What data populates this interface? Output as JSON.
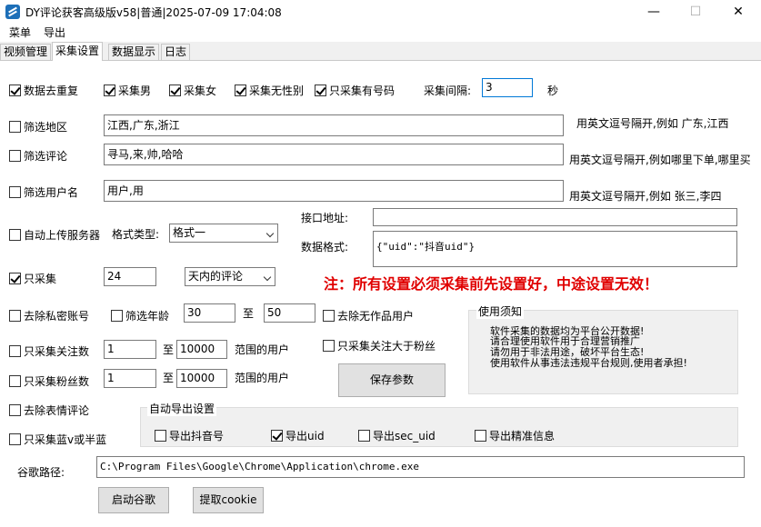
{
  "window": {
    "title": "DY评论获客高级版v58|普通|2025-07-09 17:04:08",
    "minimize": "—",
    "maximize": "☐",
    "close": "✕"
  },
  "menu": [
    "菜单",
    "导出"
  ],
  "tabs": [
    "视频管理",
    "采集设置",
    "数据显示",
    "日志"
  ],
  "row1": {
    "dedup": "数据去重复",
    "male": "采集男",
    "female": "采集女",
    "nogender": "采集无性别",
    "hasid": "只采集有号码",
    "interval_label": "采集间隔:",
    "interval_value": "3",
    "interval_unit": "秒"
  },
  "region": {
    "label": "筛选地区",
    "value": "江西,广东,浙江",
    "hint": "用英文逗号隔开,例如 广东,江西"
  },
  "comment": {
    "label": "筛选评论",
    "value": "寻马,来,帅,哈哈",
    "hint": "用英文逗号隔开,例如哪里下单,哪里买"
  },
  "username": {
    "label": "筛选用户名",
    "value": "用户,用",
    "hint": "用英文逗号隔开,例如  张三,李四"
  },
  "upload": {
    "label": "自动上传服务器",
    "format_label": "格式类型:",
    "format_value": "格式一",
    "api_label": "接口地址:",
    "api_value": "",
    "data_format_label": "数据格式:",
    "data_format_value": "{\"uid\":\"抖音uid\"}"
  },
  "only_collect": {
    "label": "只采集",
    "value": "24",
    "unit_select": "天内的评论"
  },
  "notice": "注：所有设置必须采集前先设置好，中途设置无效！",
  "private": {
    "label": "去除私密账号"
  },
  "age": {
    "label": "筛选年龄",
    "from": "30",
    "to_label": "至",
    "to": "50"
  },
  "no_works": {
    "label": "去除无作品用户"
  },
  "follow": {
    "label": "只采集关注数",
    "from": "1",
    "to_label": "至",
    "to": "10000",
    "suffix": "范围的用户"
  },
  "follow_gt_fans": {
    "label": "只采集关注大于粉丝"
  },
  "fans": {
    "label": "只采集粉丝数",
    "from": "1",
    "to_label": "至",
    "to": "10000",
    "suffix": "范围的用户"
  },
  "save_button": "保存参数",
  "usage": {
    "title": "使用须知",
    "lines": [
      "软件采集的数据均为平台公开数据!",
      "请合理使用软件用于合理营销推广",
      "请勿用于非法用途，破坏平台生态!",
      "使用软件从事违法违规平台规则,使用者承担!"
    ]
  },
  "emoji": {
    "label": "去除表情评论"
  },
  "blue_v": {
    "label": "只采集蓝v或半蓝"
  },
  "auto_export": {
    "title": "自动导出设置",
    "douyin_id": "导出抖音号",
    "uid": "导出uid",
    "sec_uid": "导出sec_uid",
    "precise": "导出精准信息"
  },
  "chrome": {
    "label": "谷歌路径:",
    "value": "C:\\Program Files\\Google\\Chrome\\Application\\chrome.exe"
  },
  "start_chrome": "启动谷歌",
  "get_cookie": "提取cookie"
}
